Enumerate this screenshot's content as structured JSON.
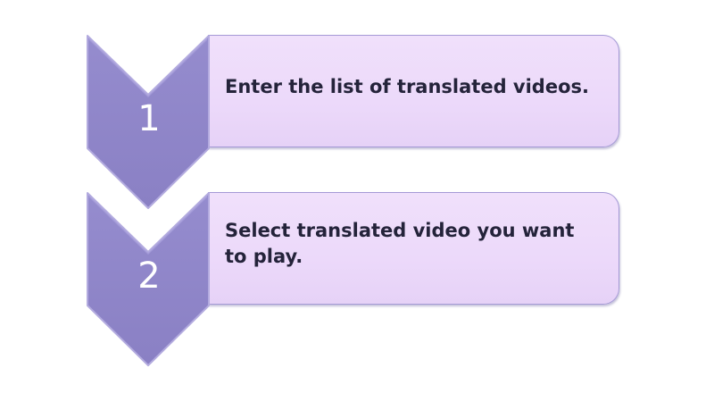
{
  "steps": [
    {
      "number": "1",
      "text": "Enter the list of translated videos."
    },
    {
      "number": "2",
      "text": "Select translated video you want to play."
    }
  ],
  "colors": {
    "chevron_fill": "#8f86c9",
    "chevron_edge": "#b8b0e2",
    "box_fill": "#eedcfa",
    "box_border": "#a59ad6",
    "text": "#24233a",
    "number": "#ffffff"
  }
}
